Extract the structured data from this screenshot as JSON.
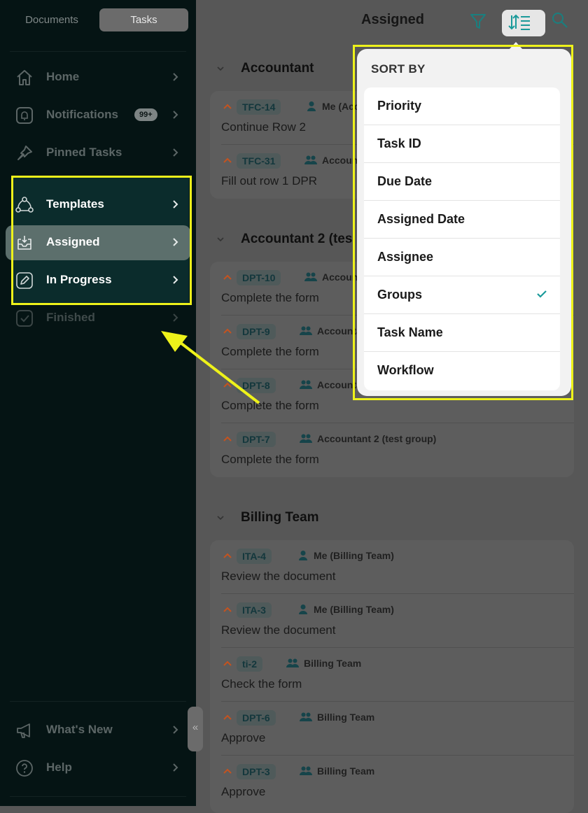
{
  "sidebar": {
    "segments": {
      "documents": "Documents",
      "tasks": "Tasks"
    },
    "items": [
      {
        "label": "Home",
        "icon": "home-icon"
      },
      {
        "label": "Notifications",
        "icon": "bell-icon",
        "badge": "99+"
      },
      {
        "label": "Pinned Tasks",
        "icon": "pin-icon"
      },
      {
        "label": "Templates",
        "icon": "templates-icon"
      },
      {
        "label": "Assigned",
        "icon": "inbox-icon"
      },
      {
        "label": "In Progress",
        "icon": "edit-icon"
      },
      {
        "label": "Finished",
        "icon": "check-square-icon"
      }
    ],
    "footer": [
      {
        "label": "What's New",
        "icon": "megaphone-icon"
      },
      {
        "label": "Help",
        "icon": "help-icon"
      }
    ],
    "collapse_glyph": "«"
  },
  "header": {
    "title": "Assigned"
  },
  "groups": [
    {
      "name": "Accountant",
      "tasks": [
        {
          "id": "TFC-14",
          "assignee": "Me (Acco",
          "assignee_type": "person",
          "name": "Continue Row 2"
        },
        {
          "id": "TFC-31",
          "assignee": "Accounta",
          "assignee_type": "group",
          "name": "Fill out row 1 DPR"
        }
      ]
    },
    {
      "name": "Accountant 2 (tes",
      "tasks": [
        {
          "id": "DPT-10",
          "assignee": "Accounta",
          "assignee_type": "group",
          "name": "Complete the form"
        },
        {
          "id": "DPT-9",
          "assignee": "Accountan",
          "assignee_type": "group",
          "name": "Complete the form"
        },
        {
          "id": "DPT-8",
          "assignee": "Accountan",
          "assignee_type": "group",
          "name": "Complete the form"
        },
        {
          "id": "DPT-7",
          "assignee": "Accountant 2 (test group)",
          "assignee_type": "group",
          "name": "Complete the form"
        }
      ]
    },
    {
      "name": "Billing Team",
      "tasks": [
        {
          "id": "ITA-4",
          "assignee": "Me (Billing Team)",
          "assignee_type": "person",
          "name": "Review the document"
        },
        {
          "id": "ITA-3",
          "assignee": "Me (Billing Team)",
          "assignee_type": "person",
          "name": "Review the document"
        },
        {
          "id": "ti-2",
          "assignee": "Billing Team",
          "assignee_type": "group",
          "name": "Check the form"
        },
        {
          "id": "DPT-6",
          "assignee": "Billing Team",
          "assignee_type": "group",
          "name": "Approve"
        },
        {
          "id": "DPT-3",
          "assignee": "Billing Team",
          "assignee_type": "group",
          "name": "Approve"
        }
      ]
    }
  ],
  "sort_menu": {
    "title": "SORT BY",
    "options": [
      "Priority",
      "Task ID",
      "Due Date",
      "Assigned Date",
      "Assignee",
      "Groups",
      "Task Name",
      "Workflow"
    ],
    "selected": "Groups"
  },
  "colors": {
    "accent_teal": "#1a9a9a",
    "priority_orange": "#c4531f",
    "annotation_yellow": "#eef21a"
  }
}
